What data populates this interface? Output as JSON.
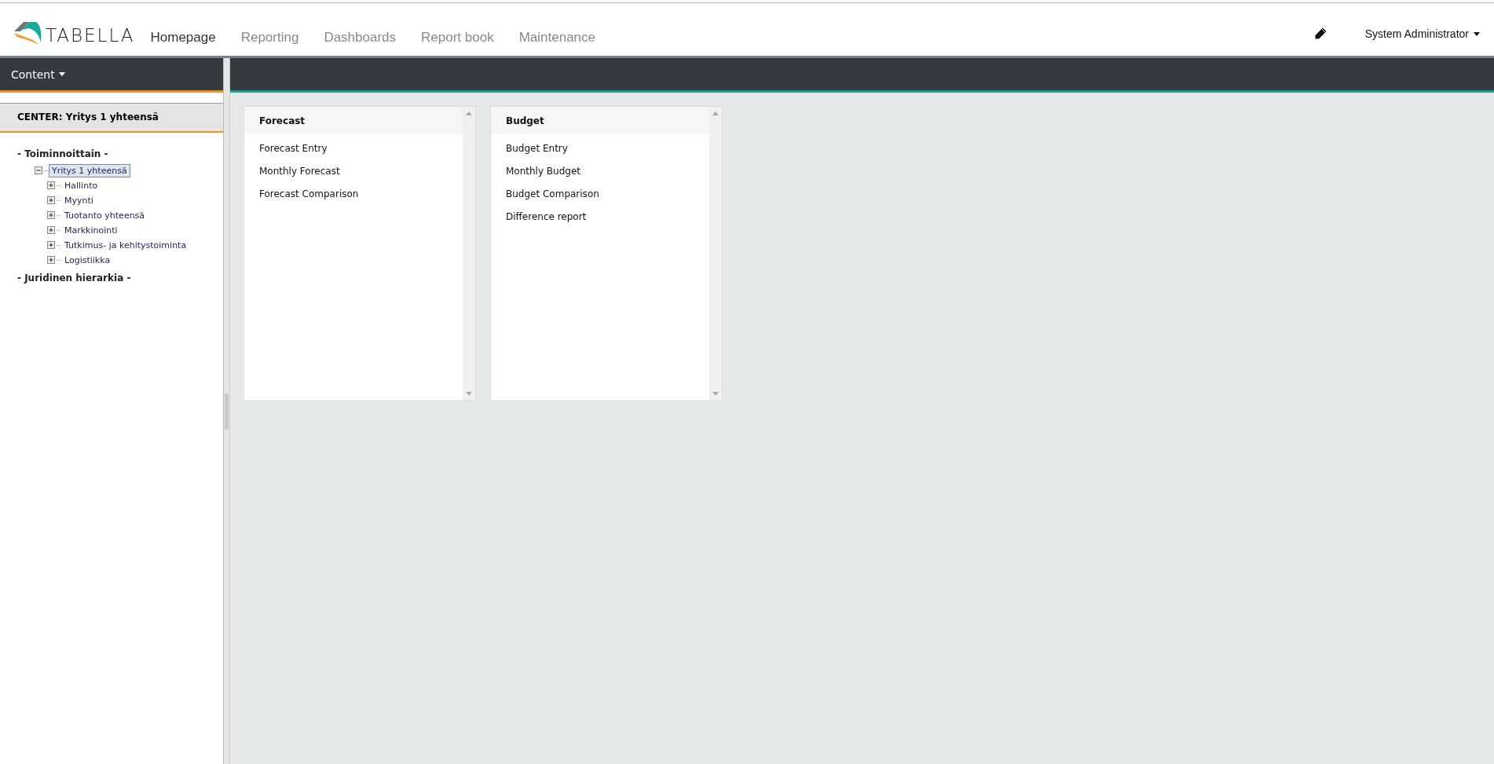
{
  "header": {
    "logo_text": "TABELLA",
    "nav": [
      {
        "label": "Homepage",
        "selected": true
      },
      {
        "label": "Reporting",
        "selected": false
      },
      {
        "label": "Dashboards",
        "selected": false
      },
      {
        "label": "Report book",
        "selected": false
      },
      {
        "label": "Maintenance",
        "selected": false
      }
    ],
    "user": "System Administrator"
  },
  "sidebar": {
    "menu": "Content",
    "center": "CENTER: Yritys 1 yhteensä",
    "tree": [
      {
        "kind": "heading",
        "label": "- Toiminnoittain -",
        "children": [
          {
            "kind": "node",
            "label": "Yritys 1 yhteensä",
            "expanded": true,
            "selected": true,
            "children": [
              {
                "kind": "node",
                "label": "Hallinto",
                "expanded": false,
                "selected": false
              },
              {
                "kind": "node",
                "label": "Myynti",
                "expanded": false,
                "selected": false
              },
              {
                "kind": "node",
                "label": "Tuotanto yhteensä",
                "expanded": false,
                "selected": false
              },
              {
                "kind": "node",
                "label": "Markkinointi",
                "expanded": false,
                "selected": false
              },
              {
                "kind": "node",
                "label": "Tutkimus- ja kehitystoiminta",
                "expanded": false,
                "selected": false
              },
              {
                "kind": "node",
                "label": "Logistiikka",
                "expanded": false,
                "selected": false
              }
            ]
          }
        ]
      },
      {
        "kind": "heading",
        "label": "- Juridinen hierarkia -"
      }
    ]
  },
  "cards": [
    {
      "title": "Forecast",
      "items": [
        "Forecast Entry",
        "Monthly Forecast",
        "Forecast Comparison"
      ]
    },
    {
      "title": "Budget",
      "items": [
        "Budget Entry",
        "Monthly Budget",
        "Budget Comparison",
        "Difference report"
      ]
    }
  ]
}
